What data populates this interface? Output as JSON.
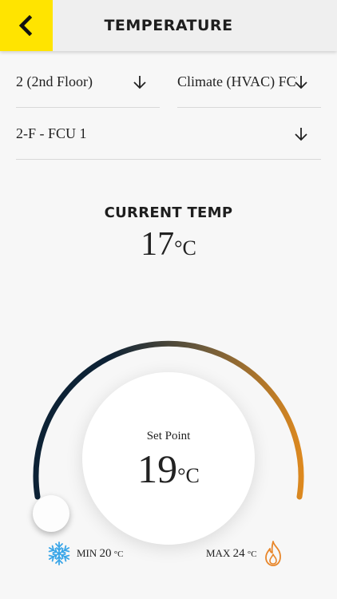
{
  "header": {
    "title": "TEMPERATURE",
    "back_icon": "chevron-left-icon",
    "accent": "#ffe400"
  },
  "filters": {
    "floor": {
      "value": "2 (2nd Floor)",
      "icon": "arrow-down-icon"
    },
    "system": {
      "value": "Climate (HVAC) FCU",
      "icon": "arrow-down-icon"
    },
    "unit": {
      "value": "2-F - FCU 1",
      "icon": "arrow-down-icon"
    }
  },
  "current": {
    "label": "CURRENT TEMP",
    "value": "17",
    "unit": "°C"
  },
  "setpoint": {
    "label": "Set Point",
    "value": "19",
    "unit": "°C"
  },
  "range": {
    "min_label": "MIN",
    "min_value": "20",
    "min_unit": "°C",
    "min_icon": "snowflake-icon",
    "max_label": "MAX",
    "max_value": "24",
    "max_unit": "°C",
    "max_icon": "flame-icon"
  },
  "colors": {
    "cold": "#0d2235",
    "hot": "#e08a1e",
    "snow": "#3aa6e8",
    "flame": "#e8862a"
  }
}
